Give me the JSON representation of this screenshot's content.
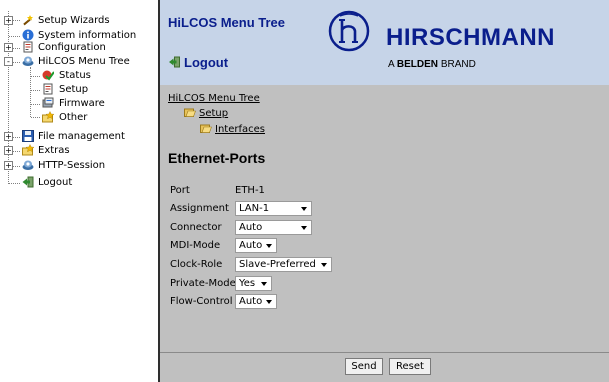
{
  "tree": {
    "items": [
      {
        "label": "Setup Wizards",
        "icon": "wand-icon",
        "expander": "+"
      },
      {
        "label": "System information",
        "icon": "info-icon",
        "expander": ""
      },
      {
        "label": "Configuration",
        "icon": "config-document-icon",
        "expander": "+"
      },
      {
        "label": "HiLCOS Menu Tree",
        "icon": "network-icon",
        "expander": "-"
      },
      {
        "label": "Status",
        "icon": "status-icon",
        "expander": ""
      },
      {
        "label": "Setup",
        "icon": "setup-document-icon",
        "expander": ""
      },
      {
        "label": "Firmware",
        "icon": "firmware-icon",
        "expander": ""
      },
      {
        "label": "Other",
        "icon": "star-folder-icon",
        "expander": ""
      },
      {
        "label": "File management",
        "icon": "floppy-disk-icon",
        "expander": "+"
      },
      {
        "label": "Extras",
        "icon": "star-folder-icon",
        "expander": "+"
      },
      {
        "label": "HTTP-Session",
        "icon": "network-icon",
        "expander": "+"
      },
      {
        "label": "Logout",
        "icon": "logout-icon",
        "expander": ""
      }
    ]
  },
  "header": {
    "title": "HiLCOS Menu Tree",
    "logout_label": "Logout",
    "brand_name": "HIRSCHMANN",
    "brand_sub_prefix": "A",
    "brand_sub_bold": "BELDEN",
    "brand_sub_suffix": "BRAND",
    "colors": {
      "brand": "#0a1e8c",
      "header_bg": "#c6d4e8",
      "content_bg": "#c0c0c0"
    }
  },
  "breadcrumb": {
    "root": "HiLCOS Menu Tree",
    "level1": "Setup",
    "level2": "Interfaces"
  },
  "page": {
    "title": "Ethernet-Ports",
    "fields": [
      {
        "label": "Port",
        "value": "ETH-1"
      },
      {
        "label": "Assignment",
        "value": "LAN-1"
      },
      {
        "label": "Connector",
        "value": "Auto"
      },
      {
        "label": "MDI-Mode",
        "value": "Auto"
      },
      {
        "label": "Clock-Role",
        "value": "Slave-Preferred"
      },
      {
        "label": "Private-Mode",
        "value": "Yes"
      },
      {
        "label": "Flow-Control",
        "value": "Auto"
      }
    ]
  },
  "footer": {
    "send_label": "Send",
    "reset_label": "Reset"
  }
}
